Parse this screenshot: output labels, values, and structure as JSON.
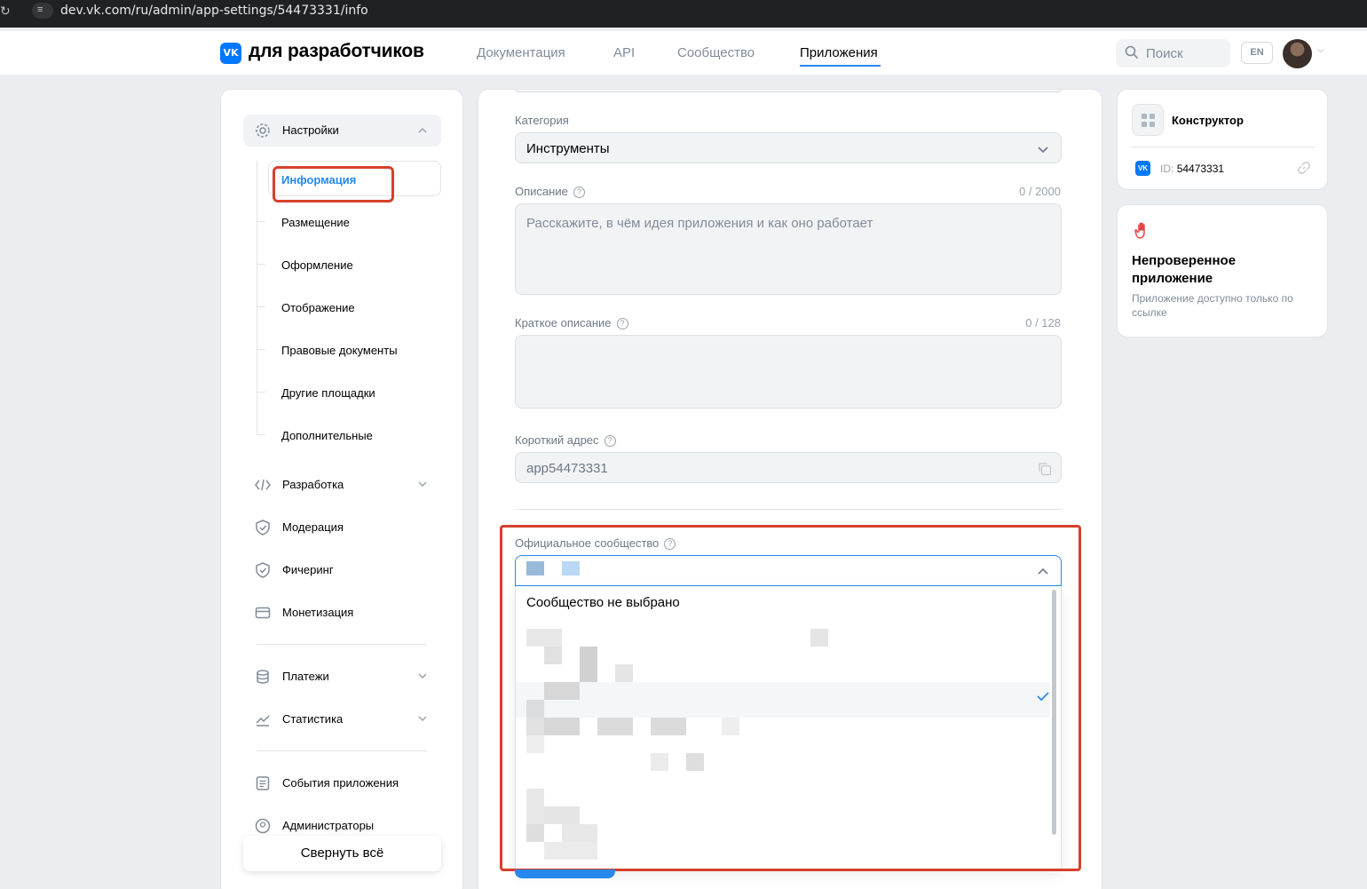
{
  "browser": {
    "url": "dev.vk.com/ru/admin/app-settings/54473331/info"
  },
  "header": {
    "logo_text": "для разработчиков",
    "logo_mark": "VK",
    "nav": [
      "Документация",
      "API",
      "Сообщество",
      "Приложения"
    ],
    "active_nav": "Приложения",
    "search_placeholder": "Поиск",
    "lang": "EN"
  },
  "sidebar": {
    "settings_label": "Настройки",
    "settings_items": [
      "Информация",
      "Размещение",
      "Оформление",
      "Отображение",
      "Правовые документы",
      "Другие площадки",
      "Дополнительные"
    ],
    "active_item": "Информация",
    "dev_label": "Разработка",
    "moderation_label": "Модерация",
    "featuring_label": "Фичеринг",
    "monetization_label": "Монетизация",
    "payments_label": "Платежи",
    "stats_label": "Статистика",
    "events_label": "События приложения",
    "admins_label": "Администраторы",
    "collapse_label": "Свернуть всё"
  },
  "form": {
    "category": {
      "label": "Категория",
      "value": "Инструменты"
    },
    "description": {
      "label": "Описание",
      "counter": "0 / 2000",
      "placeholder": "Расскажите, в чём идея приложения и как оно работает"
    },
    "short_description": {
      "label": "Краткое описание",
      "counter": "0 / 128"
    },
    "short_address": {
      "label": "Короткий адрес",
      "value": "app54473331"
    },
    "community": {
      "label": "Официальное сообщество",
      "options": [
        "Сообщество не выбрано"
      ]
    }
  },
  "right": {
    "builder_title": "Конструктор",
    "id_label": "ID:",
    "id_value": "54473331",
    "warning_title": "Непроверенное приложение",
    "warning_text": "Приложение доступно только по ссылке"
  },
  "colors": {
    "accent": "#2688eb",
    "brand": "#0077ff",
    "highlight": "#d7402c",
    "warning_icon": "#e64646"
  }
}
